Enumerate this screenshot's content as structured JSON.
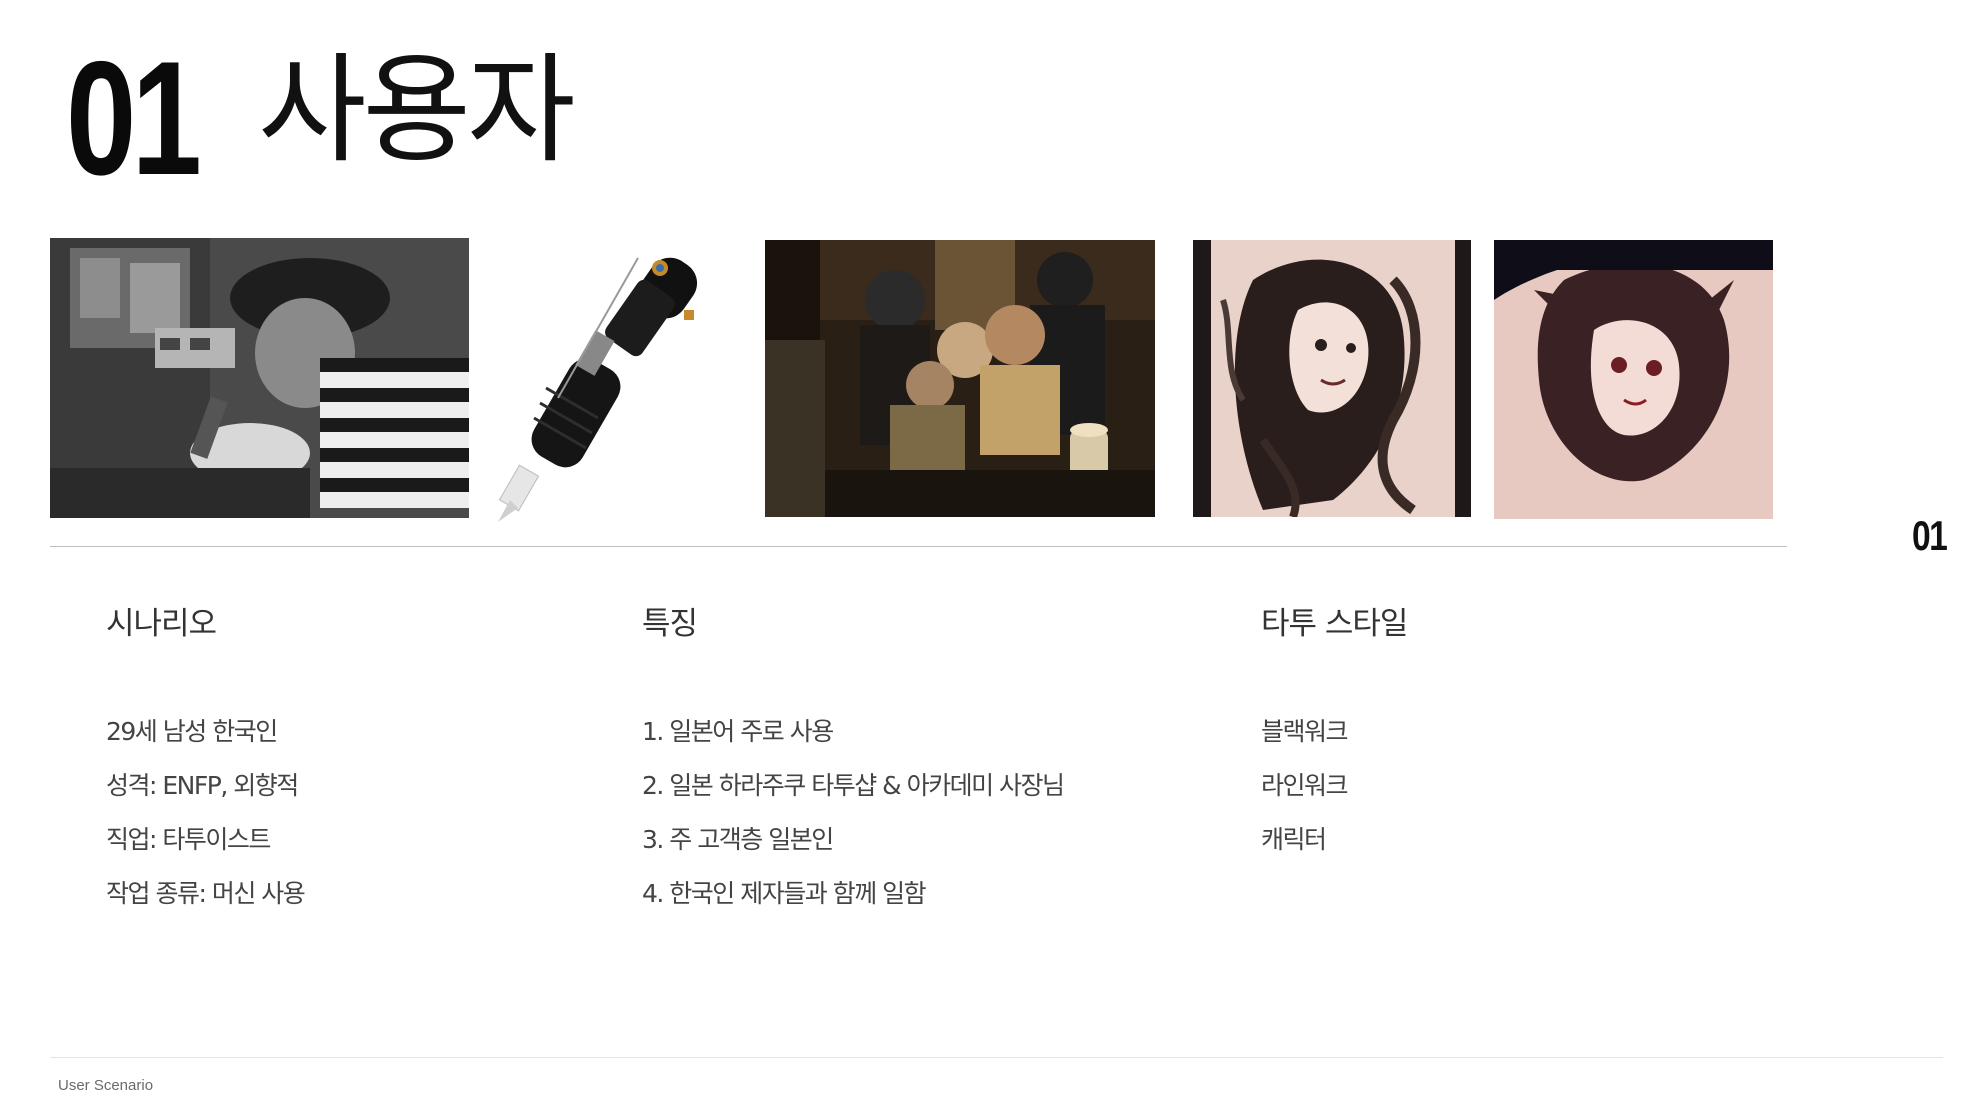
{
  "header": {
    "number": "01",
    "title": "사용자"
  },
  "side_number": "01",
  "photos": [
    {
      "icon": "tattoo-artist-working-photo"
    },
    {
      "icon": "tattoo-machine-photo"
    },
    {
      "icon": "tattoo-studio-group-photo"
    },
    {
      "icon": "blackwork-girl-forearm-tattoo-photo"
    },
    {
      "icon": "character-girl-forearm-tattoo-photo"
    }
  ],
  "columns": {
    "scenario": {
      "heading": "시나리오",
      "items": [
        "29세 남성 한국인",
        "성격: ENFP, 외향적",
        "직업: 타투이스트",
        "작업 종류: 머신 사용"
      ]
    },
    "features": {
      "heading": "특징",
      "items": [
        "1. 일본어 주로 사용",
        "2. 일본 하라주쿠 타투샵 & 아카데미 사장님",
        "3. 주 고객층 일본인",
        "4. 한국인 제자들과 함께 일함"
      ]
    },
    "tattoo_style": {
      "heading": "타투 스타일",
      "items": [
        "블랙워크",
        "라인워크",
        "캐릭터"
      ]
    }
  },
  "footer": {
    "label": "User Scenario"
  }
}
